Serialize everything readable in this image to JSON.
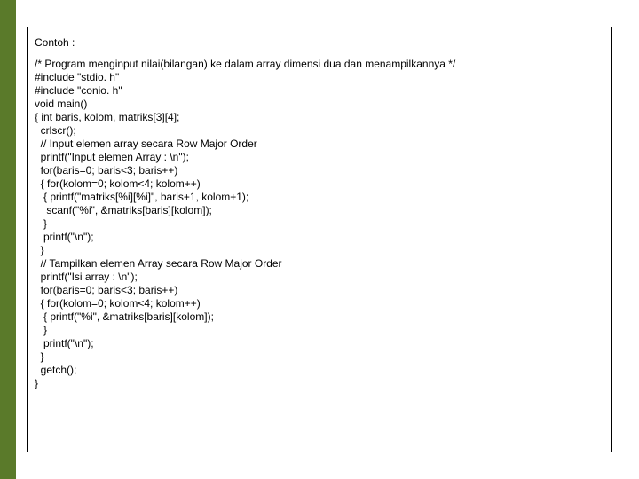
{
  "title": "Contoh :",
  "code": "/* Program menginput nilai(bilangan) ke dalam array dimensi dua dan menampilkannya */\n#include \"stdio. h\"\n#include \"conio. h\"\nvoid main()\n{ int baris, kolom, matriks[3][4];\n  crlscr();\n  // Input elemen array secara Row Major Order\n  printf(\"Input elemen Array : \\n\");\n  for(baris=0; baris<3; baris++)\n  { for(kolom=0; kolom<4; kolom++)\n   { printf(\"matriks[%i][%i]\", baris+1, kolom+1);\n    scanf(\"%i\", &matriks[baris][kolom]);\n   }\n   printf(\"\\n\");\n  }\n  // Tampilkan elemen Array secara Row Major Order\n  printf(\"Isi array : \\n\");\n  for(baris=0; baris<3; baris++)\n  { for(kolom=0; kolom<4; kolom++)\n   { printf(\"%i\", &matriks[baris][kolom]);\n   }\n   printf(\"\\n\");\n  }\n  getch();\n}"
}
